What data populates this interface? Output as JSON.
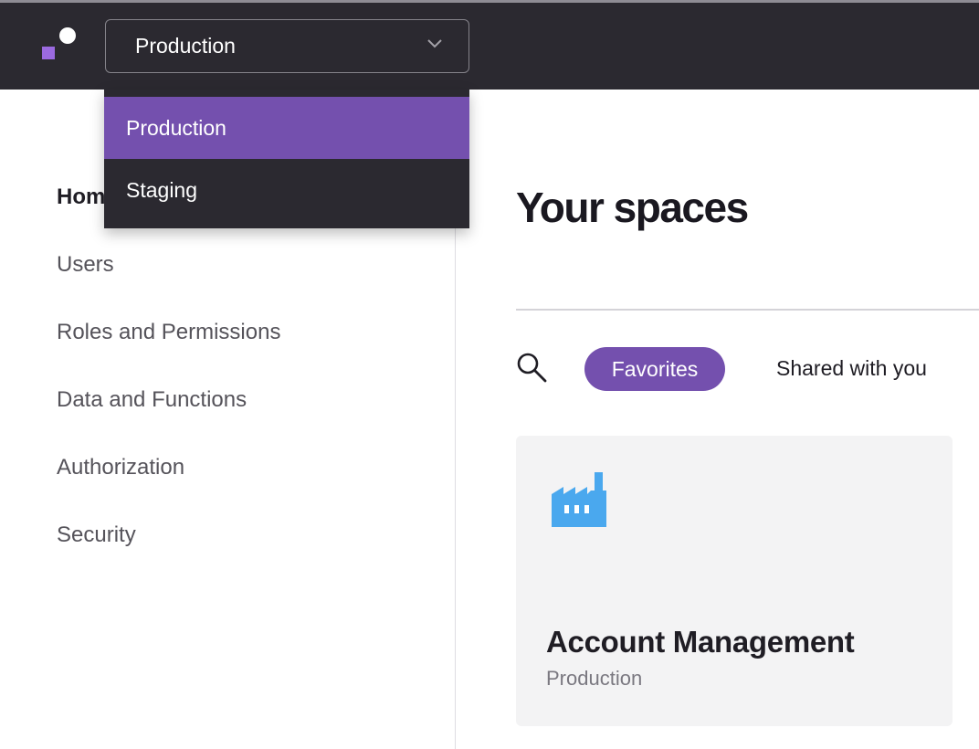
{
  "colors": {
    "topbar_bg": "#2b2930",
    "accent_purple": "#7450ae",
    "logo_purple": "#9b6ae0",
    "factory_blue": "#4aa8ee",
    "card_bg": "#f3f3f4"
  },
  "header": {
    "logo_icon": "app-logo",
    "env_select": {
      "value": "Production",
      "icon": "chevron-down-icon"
    },
    "env_dropdown": {
      "options": [
        "Production",
        "Staging"
      ],
      "selected": "Production"
    }
  },
  "sidebar": {
    "items": [
      {
        "label": "Home",
        "active": true
      },
      {
        "label": "Users"
      },
      {
        "label": "Roles and Permissions"
      },
      {
        "label": "Data and Functions"
      },
      {
        "label": "Authorization"
      },
      {
        "label": "Security"
      }
    ]
  },
  "main": {
    "title": "Your spaces",
    "search_icon": "search-icon",
    "filters": [
      {
        "label": "Favorites",
        "active": true
      },
      {
        "label": "Shared with you"
      }
    ],
    "cards": [
      {
        "icon": "factory-icon",
        "name": "Account Management",
        "env": "Production"
      }
    ]
  }
}
